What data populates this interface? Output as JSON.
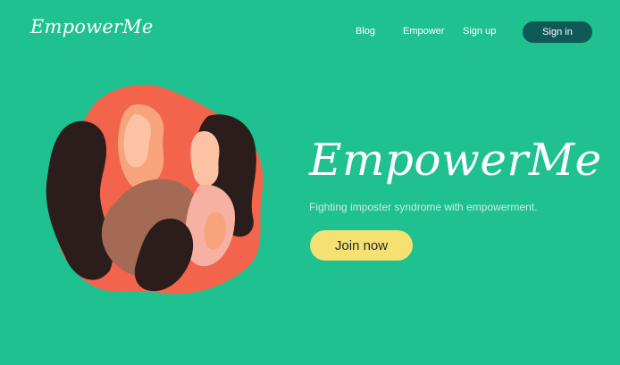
{
  "header": {
    "logo": "EmpowerMe",
    "nav": [
      {
        "label": "Blog"
      },
      {
        "label": "Empower"
      },
      {
        "label": "Sign up"
      }
    ],
    "signin_label": "Sign in"
  },
  "hero": {
    "title": "EmpowerMe",
    "subtitle": "Fighting imposter syndrome with empowerment.",
    "cta_label": "Join now"
  },
  "colors": {
    "background": "#1fc191",
    "signin_button": "#0f5a57",
    "cta_button": "#f5e172",
    "illustration_blob": "#f3644c"
  },
  "illustration": {
    "icon": "women-profiles-illustration"
  }
}
